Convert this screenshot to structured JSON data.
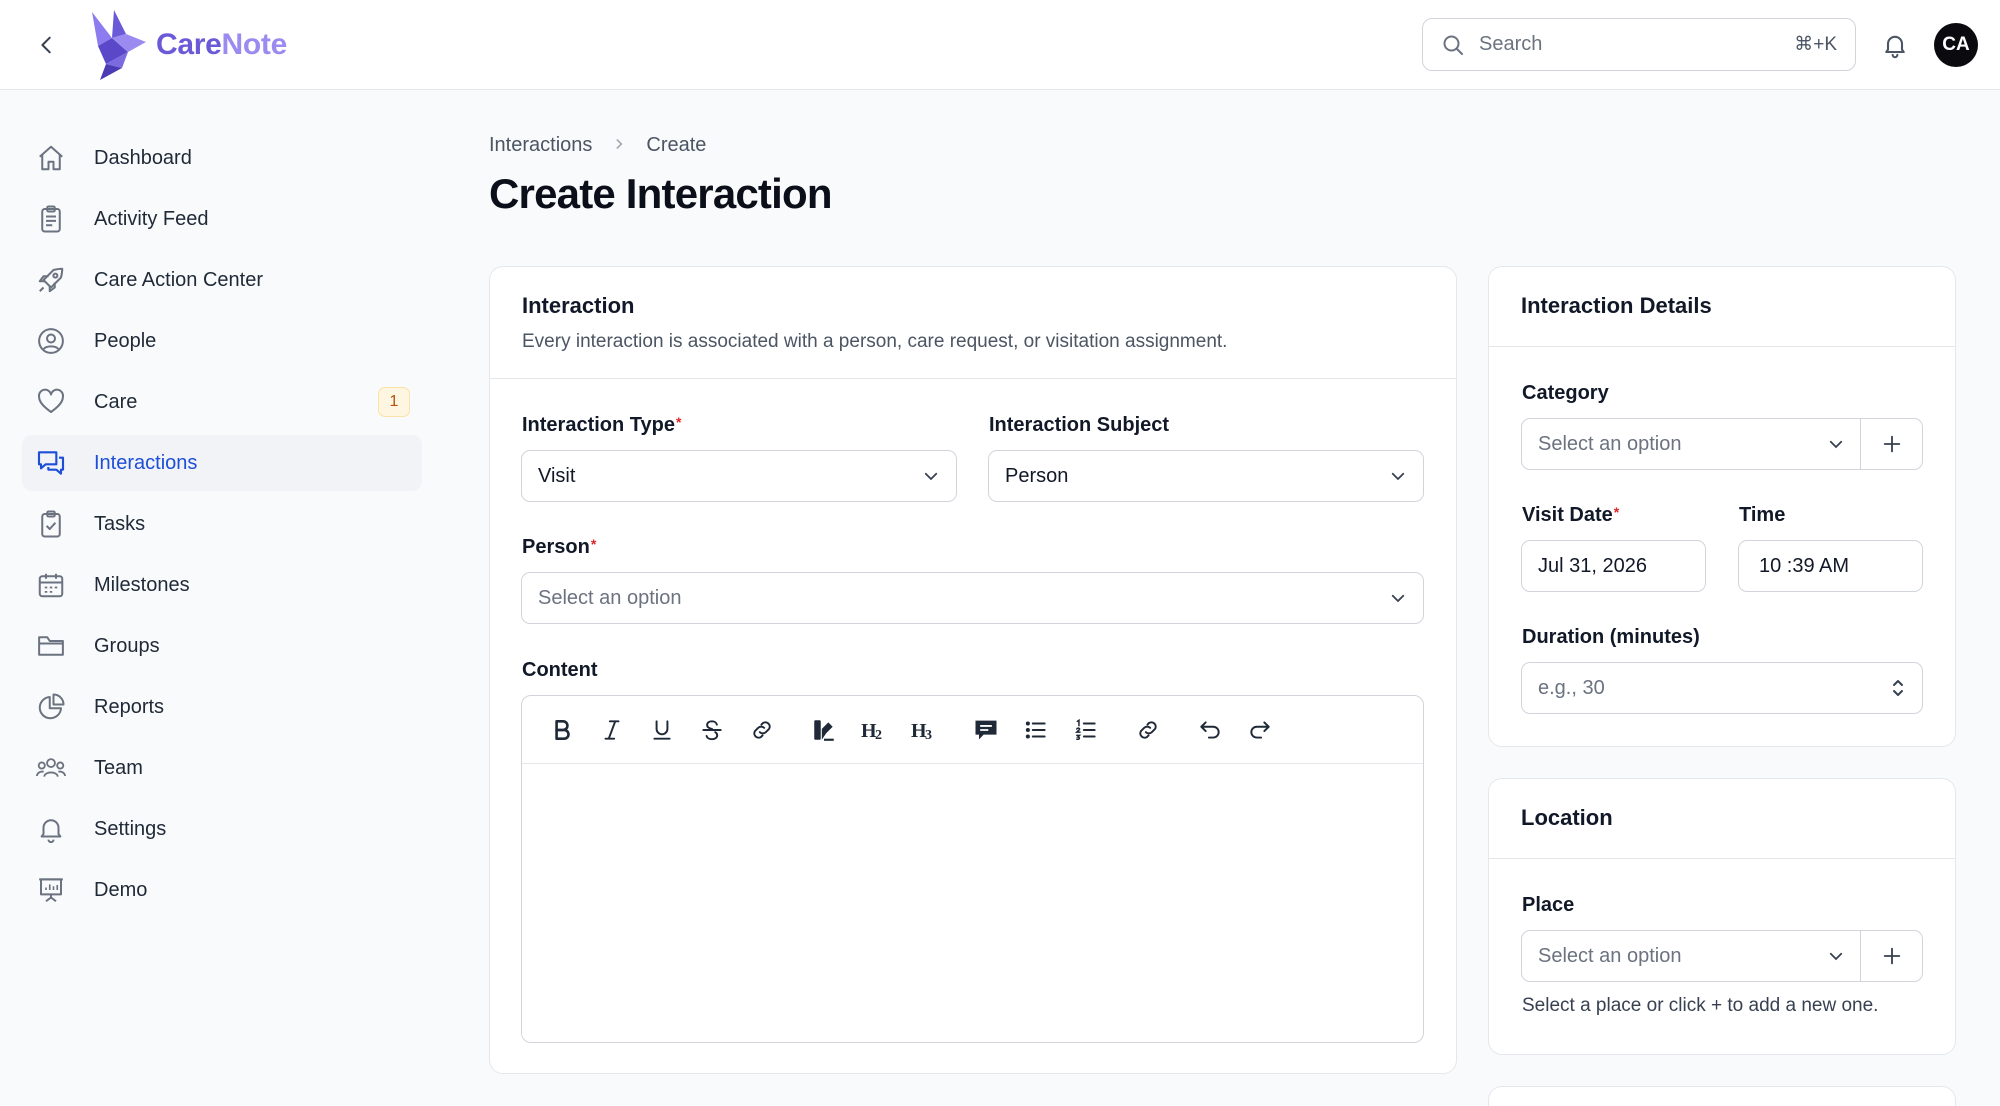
{
  "app": {
    "name_part1": "Care",
    "name_part2": "Note",
    "brand_colors": [
      "#6a5ad8",
      "#9b8bf0"
    ]
  },
  "header": {
    "search_placeholder": "Search",
    "search_shortcut": "⌘+K",
    "avatar_initials": "CA"
  },
  "sidebar": {
    "items": [
      {
        "label": "Dashboard",
        "icon": "home-icon"
      },
      {
        "label": "Activity Feed",
        "icon": "clipboard-icon"
      },
      {
        "label": "Care Action Center",
        "icon": "rocket-icon"
      },
      {
        "label": "People",
        "icon": "user-circle-icon"
      },
      {
        "label": "Care",
        "icon": "heart-icon",
        "badge": "1"
      },
      {
        "label": "Interactions",
        "icon": "chat-bubbles-icon",
        "active": true
      },
      {
        "label": "Tasks",
        "icon": "clipboard-check-icon"
      },
      {
        "label": "Milestones",
        "icon": "calendar-icon"
      },
      {
        "label": "Groups",
        "icon": "folder-icon"
      },
      {
        "label": "Reports",
        "icon": "pie-chart-icon"
      },
      {
        "label": "Team",
        "icon": "users-icon"
      },
      {
        "label": "Settings",
        "icon": "bell-icon"
      },
      {
        "label": "Demo",
        "icon": "presentation-icon"
      }
    ]
  },
  "breadcrumb": {
    "items": [
      "Interactions",
      "Create"
    ]
  },
  "page": {
    "title": "Create Interaction"
  },
  "interaction_card": {
    "title": "Interaction",
    "description": "Every interaction is associated with a person, care request, or visitation assignment.",
    "type_label": "Interaction Type",
    "type_value": "Visit",
    "subject_label": "Interaction Subject",
    "subject_value": "Person",
    "person_label": "Person",
    "person_placeholder": "Select an option",
    "content_label": "Content"
  },
  "editor_toolbar": [
    "bold-icon",
    "italic-icon",
    "underline-icon",
    "strikethrough-icon",
    "link-icon",
    "highlight-icon",
    "heading2-icon",
    "heading3-icon",
    "comment-icon",
    "bullet-list-icon",
    "numbered-list-icon",
    "attachment-icon",
    "undo-icon",
    "redo-icon"
  ],
  "details_card": {
    "title": "Interaction Details",
    "category_label": "Category",
    "category_placeholder": "Select an option",
    "visit_date_label": "Visit Date",
    "visit_date_value": "Jul 31, 2026",
    "time_label": "Time",
    "time_value": "10 :39 AM",
    "duration_label": "Duration (minutes)",
    "duration_placeholder": "e.g., 30"
  },
  "location_card": {
    "title": "Location",
    "place_label": "Place",
    "place_placeholder": "Select an option",
    "place_helper": "Select a place or click + to add a new one."
  }
}
